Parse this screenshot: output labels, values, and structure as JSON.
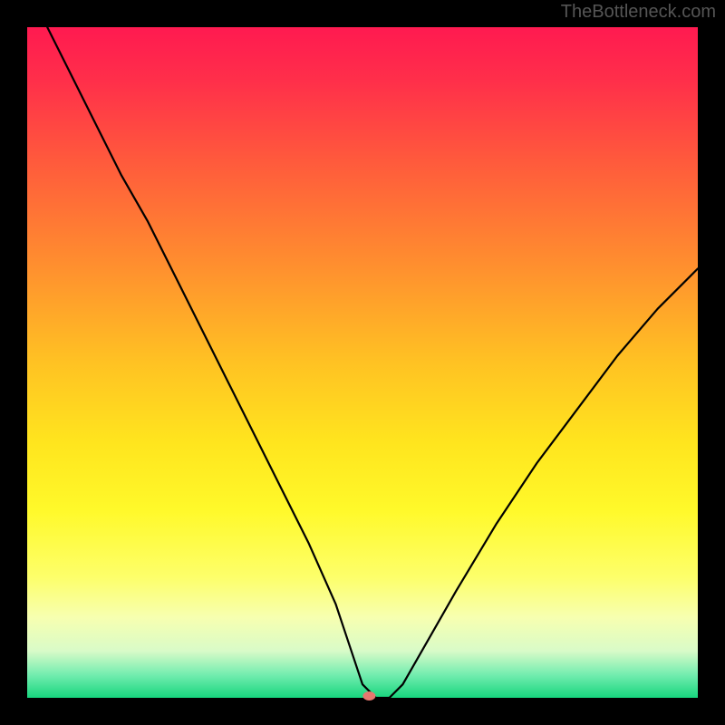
{
  "watermark": "TheBottleneck.com",
  "chart_data": {
    "type": "line",
    "title": "",
    "xlabel": "",
    "ylabel": "",
    "xlim": [
      0,
      100
    ],
    "ylim": [
      0,
      100
    ],
    "grid": false,
    "legend": false,
    "background": {
      "type": "vertical-gradient",
      "stops": [
        {
          "offset": 0.0,
          "color": "#ff1a50"
        },
        {
          "offset": 0.08,
          "color": "#ff2f4a"
        },
        {
          "offset": 0.2,
          "color": "#ff5a3c"
        },
        {
          "offset": 0.35,
          "color": "#ff8d2f"
        },
        {
          "offset": 0.5,
          "color": "#ffc223"
        },
        {
          "offset": 0.62,
          "color": "#ffe51e"
        },
        {
          "offset": 0.72,
          "color": "#fff92a"
        },
        {
          "offset": 0.82,
          "color": "#fdff6a"
        },
        {
          "offset": 0.88,
          "color": "#f7ffb0"
        },
        {
          "offset": 0.93,
          "color": "#d9fbc8"
        },
        {
          "offset": 0.965,
          "color": "#75edb0"
        },
        {
          "offset": 1.0,
          "color": "#17d67e"
        }
      ]
    },
    "minimum_marker": {
      "x": 51,
      "y": 0,
      "color": "#e7776f",
      "rx": 7,
      "ry": 5
    },
    "series": [
      {
        "name": "bottleneck-curve",
        "color": "#000000",
        "width": 2.2,
        "x": [
          3,
          6,
          10,
          14,
          18,
          22,
          26,
          30,
          34,
          38,
          42,
          46,
          48,
          50,
          52,
          54,
          56,
          60,
          64,
          70,
          76,
          82,
          88,
          94,
          100
        ],
        "y": [
          100,
          94,
          86,
          78,
          71,
          63,
          55,
          47,
          39,
          31,
          23,
          14,
          8,
          2,
          0,
          0,
          2,
          9,
          16,
          26,
          35,
          43,
          51,
          58,
          64
        ]
      }
    ]
  }
}
